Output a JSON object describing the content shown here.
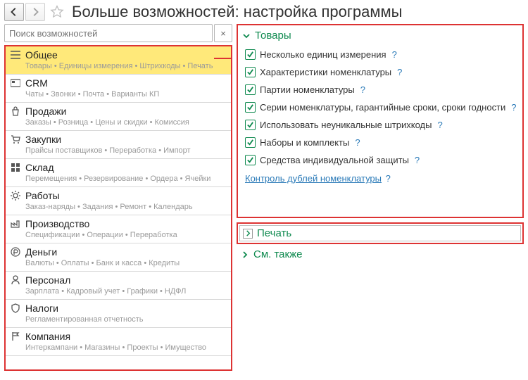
{
  "title": "Больше возможностей: настройка программы",
  "search": {
    "placeholder": "Поиск возможностей"
  },
  "categories": [
    {
      "label": "Общее",
      "sub": "Товары • Единицы измерения • Штрихкоды • Печать",
      "selected": true,
      "icon": "list"
    },
    {
      "label": "CRM",
      "sub": "Чаты • Звонки • Почта • Варианты КП",
      "icon": "card"
    },
    {
      "label": "Продажи",
      "sub": "Заказы • Розница • Цены и скидки • Комиссия",
      "icon": "bag"
    },
    {
      "label": "Закупки",
      "sub": "Прайсы поставщиков • Переработка • Импорт",
      "icon": "cart"
    },
    {
      "label": "Склад",
      "sub": "Перемещения • Резервирование • Ордера • Ячейки",
      "icon": "grid"
    },
    {
      "label": "Работы",
      "sub": "Заказ-наряды • Задания • Ремонт • Календарь",
      "icon": "gear"
    },
    {
      "label": "Производство",
      "sub": "Спецификации • Операции • Переработка",
      "icon": "factory"
    },
    {
      "label": "Деньги",
      "sub": "Валюты • Оплаты • Банк и касса • Кредиты",
      "icon": "ruble"
    },
    {
      "label": "Персонал",
      "sub": "Зарплата • Кадровый учет • Графики • НДФЛ",
      "icon": "person"
    },
    {
      "label": "Налоги",
      "sub": "Регламентированная отчетность",
      "icon": "shield"
    },
    {
      "label": "Компания",
      "sub": "Интеркампани • Магазины • Проекты • Имущество",
      "icon": "flag"
    }
  ],
  "section_goods": {
    "title": "Товары",
    "options": [
      "Несколько единиц измерения",
      "Характеристики номенклатуры",
      "Партии номенклатуры",
      "Серии номенклатуры, гарантийные сроки, сроки годности",
      "Использовать неуникальные штрихкоды",
      "Наборы и комплекты",
      "Средства индивидуальной защиты"
    ],
    "link": "Контроль дублей номенклатуры"
  },
  "section_print": {
    "title": "Печать"
  },
  "section_seealso": {
    "title": "См. также"
  },
  "help_char": "?"
}
